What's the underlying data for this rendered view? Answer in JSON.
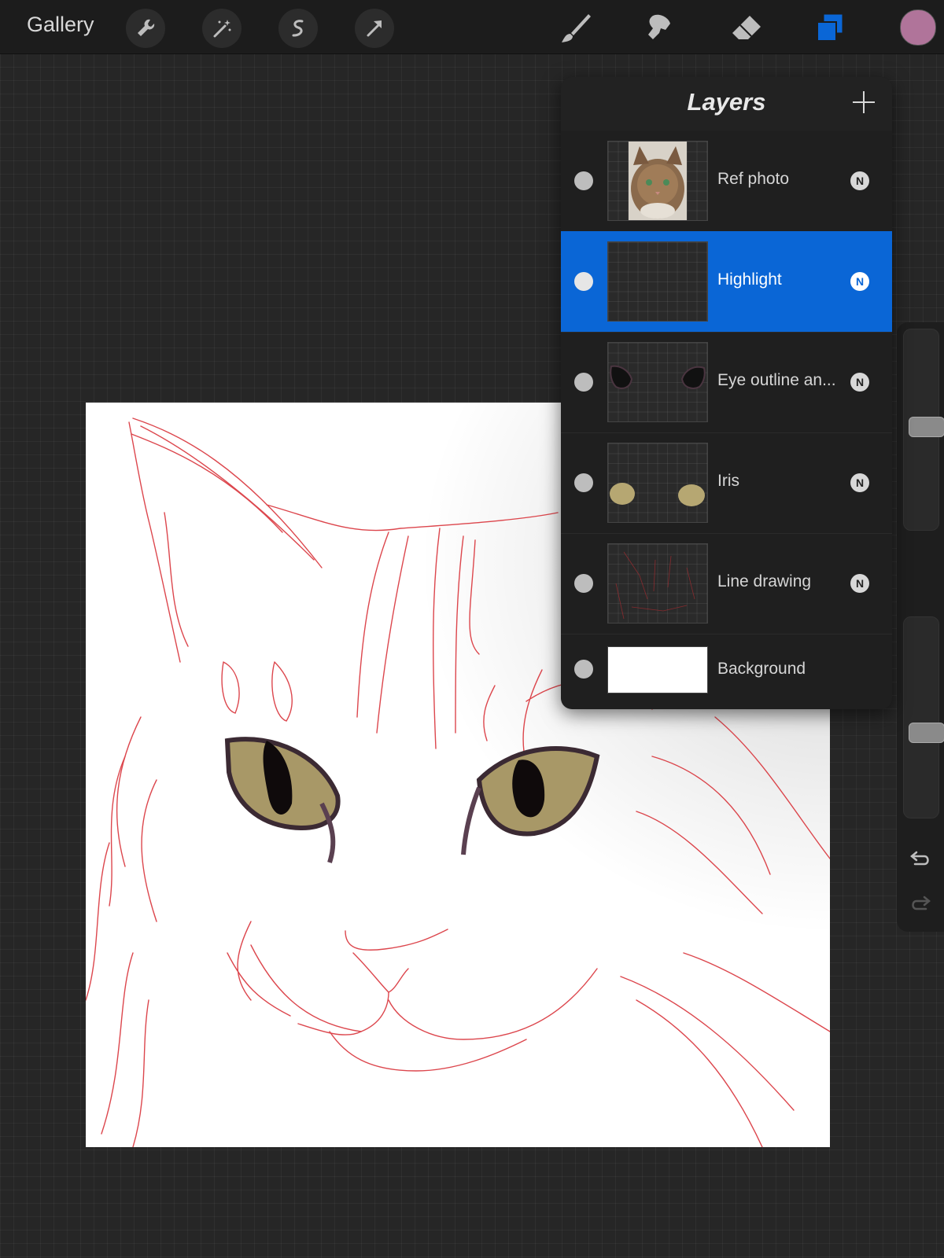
{
  "topbar": {
    "gallery_label": "Gallery",
    "tools": [
      "wrench-icon",
      "magic-wand-icon",
      "selection-icon",
      "transform-arrow-icon"
    ],
    "paint_tools": [
      "brush-icon",
      "smudge-icon",
      "eraser-icon",
      "layers-icon"
    ],
    "active_paint_tool": "layers-icon",
    "current_color": "#b0749a",
    "accent_color": "#0a66d6"
  },
  "layers": {
    "title": "Layers",
    "add_icon": "plus-icon",
    "items": [
      {
        "name": "Ref photo",
        "blend": "N",
        "selected": false,
        "thumb": "photo"
      },
      {
        "name": "Highlight",
        "blend": "N",
        "selected": true,
        "thumb": "empty"
      },
      {
        "name": "Eye outline an...",
        "blend": "N",
        "selected": false,
        "thumb": "eye-outline"
      },
      {
        "name": "Iris",
        "blend": "N",
        "selected": false,
        "thumb": "iris"
      },
      {
        "name": "Line drawing",
        "blend": "N",
        "selected": false,
        "thumb": "lines"
      },
      {
        "name": "Background",
        "blend": "",
        "selected": false,
        "thumb": "white"
      }
    ]
  },
  "sidebar": {
    "brush_size_level": 0.52,
    "opacity_level": 0.42,
    "undo_icon": "undo-icon",
    "redo_icon": "redo-icon"
  }
}
